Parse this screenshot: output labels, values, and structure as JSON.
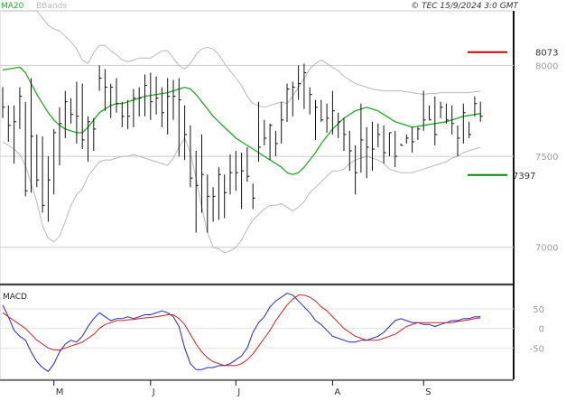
{
  "header": {
    "copyright": "© TEC 15/9/2024 3:0 GMT",
    "legend": [
      {
        "label": "MA20",
        "color": "#22aa22"
      },
      {
        "label": "BBands",
        "color": "#b8b8b8"
      }
    ]
  },
  "macd_panel": {
    "title": "MACD"
  },
  "colors": {
    "price_bars": "#111111",
    "ma20": "#22aa22",
    "bbands": "#b8b8b8",
    "macd_line": "#2222cc",
    "signal_line": "#cc2222",
    "resistance": "#cc0000",
    "support": "#008800",
    "gridline": "#cccccc"
  },
  "levels": [
    {
      "name": "resistance",
      "label": "8073",
      "value": 8073
    },
    {
      "name": "support",
      "label": "7397",
      "value": 7397
    }
  ],
  "chart_data": [
    {
      "type": "line",
      "panel": "price",
      "title": "",
      "xlabel": "",
      "ylabel": "",
      "x_ticks": [
        "M",
        "J",
        "J",
        "A",
        "S"
      ],
      "y_ticks": [
        "8000",
        "7500",
        "7000"
      ],
      "ylim": [
        6800,
        8300
      ],
      "grid": true,
      "legend_position": "top-left",
      "series": [
        {
          "name": "MA20",
          "style": "line",
          "values": [
            7975,
            7980,
            7985,
            7990,
            7960,
            7900,
            7840,
            7790,
            7740,
            7700,
            7670,
            7650,
            7640,
            7630,
            7630,
            7660,
            7700,
            7740,
            7760,
            7780,
            7790,
            7790,
            7800,
            7810,
            7820,
            7830,
            7835,
            7840,
            7845,
            7850,
            7860,
            7870,
            7880,
            7870,
            7840,
            7800,
            7760,
            7720,
            7690,
            7660,
            7630,
            7600,
            7580,
            7560,
            7540,
            7520,
            7500,
            7480,
            7460,
            7440,
            7410,
            7400,
            7410,
            7440,
            7480,
            7520,
            7570,
            7610,
            7650,
            7680,
            7710,
            7730,
            7750,
            7760,
            7770,
            7760,
            7750,
            7730,
            7710,
            7690,
            7680,
            7670,
            7660,
            7665,
            7670,
            7675,
            7680,
            7685,
            7690,
            7700,
            7710,
            7720,
            7725,
            7730,
            7735
          ]
        },
        {
          "name": "BBands",
          "style": "line",
          "values": [
            8300,
            8300,
            8300,
            8300,
            8300,
            8300,
            8300,
            8260,
            8220,
            8200,
            8190,
            8160,
            8130,
            8090,
            8030,
            8010,
            8070,
            8110,
            8110,
            8080,
            8060,
            8030,
            8020,
            8030,
            8040,
            8040,
            8040,
            8060,
            8080,
            8080,
            8040,
            8000,
            7980,
            8010,
            8060,
            8090,
            8100,
            8090,
            8060,
            8010,
            7970,
            7930,
            7890,
            7830,
            7790,
            7780,
            7770,
            7780,
            7790,
            7800,
            7790,
            7830,
            7880,
            7930,
            7980,
            8010,
            8030,
            8010,
            7990,
            7970,
            7940,
            7920,
            7900,
            7890,
            7880,
            7870,
            7865,
            7860,
            7860,
            7860,
            7860,
            7855,
            7850,
            7845,
            7840,
            7845,
            7845,
            7850,
            7850,
            7850,
            7850,
            7850,
            7850,
            7855,
            7860
          ]
        },
        {
          "name": "BBands",
          "style": "line",
          "values": [
            7580,
            7560,
            7540,
            7510,
            7450,
            7350,
            7250,
            7120,
            7050,
            7030,
            7060,
            7140,
            7230,
            7290,
            7320,
            7390,
            7430,
            7470,
            7480,
            7480,
            7490,
            7500,
            7500,
            7510,
            7500,
            7490,
            7480,
            7470,
            7460,
            7450,
            7490,
            7550,
            7600,
            7520,
            7380,
            7220,
            7080,
            7000,
            6990,
            6970,
            6980,
            7000,
            7040,
            7100,
            7150,
            7180,
            7210,
            7230,
            7230,
            7240,
            7220,
            7200,
            7220,
            7250,
            7300,
            7330,
            7360,
            7390,
            7420,
            7420,
            7430,
            7460,
            7480,
            7490,
            7500,
            7490,
            7480,
            7460,
            7430,
            7420,
            7410,
            7410,
            7410,
            7420,
            7430,
            7440,
            7450,
            7460,
            7470,
            7490,
            7500,
            7520,
            7530,
            7540,
            7550
          ]
        },
        {
          "name": "Price",
          "style": "bars",
          "high": [
            7880,
            7780,
            7780,
            7880,
            7800,
            7930,
            7620,
            7610,
            7500,
            7650,
            7770,
            7860,
            7820,
            7910,
            7900,
            7720,
            7710,
            8000,
            7980,
            7900,
            7930,
            7800,
            7810,
            7870,
            7880,
            7950,
            7960,
            7940,
            7880,
            7930,
            7920,
            7930,
            7780,
            7670,
            7530,
            7620,
            7400,
            7330,
            7440,
            7400,
            7510,
            7530,
            7520,
            7550,
            7350,
            7800,
            7700,
            7680,
            7640,
            7800,
            7900,
            7910,
            8000,
            8010,
            7880,
            7810,
            7810,
            7790,
            7860,
            7740,
            7710,
            7640,
            7560,
            7790,
            7660,
            7690,
            7680,
            7670,
            7630,
            7640,
            7570,
            7620,
            7660,
            7660,
            7860,
            7780,
            7830,
            7800,
            7790,
            7780,
            7670,
            7790,
            7690,
            7830,
            7800
          ],
          "low": [
            7710,
            7580,
            7460,
            7650,
            7280,
            7300,
            7330,
            7190,
            7140,
            7290,
            7450,
            7600,
            7680,
            7570,
            7540,
            7470,
            7530,
            7860,
            7750,
            7710,
            7740,
            7660,
            7650,
            7660,
            7720,
            7720,
            7700,
            7730,
            7660,
            7620,
            7700,
            7500,
            7480,
            7330,
            7080,
            7190,
            7080,
            7140,
            7150,
            7160,
            7290,
            7310,
            7210,
            7360,
            7210,
            7470,
            7560,
            7480,
            7500,
            7570,
            7690,
            7720,
            7810,
            7760,
            7730,
            7590,
            7690,
            7630,
            7620,
            7600,
            7530,
            7420,
            7290,
            7410,
            7380,
            7420,
            7550,
            7460,
            7500,
            7440,
            7560,
            7570,
            7520,
            7590,
            7640,
            7700,
            7560,
            7710,
            7680,
            7620,
            7500,
            7570,
            7600,
            7720,
            7690
          ],
          "close": [
            7770,
            7670,
            7690,
            7830,
            7310,
            7610,
            7370,
            7230,
            7370,
            7630,
            7680,
            7800,
            7730,
            7720,
            7590,
            7690,
            7650,
            7930,
            7880,
            7880,
            7790,
            7720,
            7720,
            7820,
            7820,
            7890,
            7800,
            7820,
            7740,
            7830,
            7830,
            7810,
            7620,
            7380,
            7340,
            7400,
            7280,
            7280,
            7400,
            7300,
            7410,
            7410,
            7420,
            7390,
            7270,
            7550,
            7600,
            7670,
            7570,
            7700,
            7870,
            7880,
            7900,
            7960,
            7840,
            7770,
            7700,
            7710,
            7750,
            7690,
            7620,
            7530,
            7410,
            7590,
            7550,
            7540,
            7620,
            7520,
            7630,
            7500,
            7560,
            7600,
            7580,
            7650,
            7700,
            7700,
            7620,
            7770,
            7700,
            7680,
            7600,
            7740,
            7620,
            7790,
            7720
          ]
        }
      ]
    },
    {
      "type": "line",
      "panel": "macd",
      "title": "MACD",
      "y_ticks": [
        "50",
        "0",
        "-50"
      ],
      "ylim": [
        -130,
        110
      ],
      "grid": true,
      "series": [
        {
          "name": "MACD",
          "values": [
            60,
            30,
            -5,
            -20,
            -30,
            -60,
            -85,
            -100,
            -110,
            -90,
            -60,
            -40,
            -30,
            -35,
            -20,
            5,
            25,
            40,
            30,
            20,
            25,
            25,
            30,
            25,
            30,
            35,
            35,
            40,
            45,
            40,
            30,
            5,
            -50,
            -90,
            -105,
            -105,
            -100,
            -100,
            -95,
            -95,
            -90,
            -80,
            -70,
            -50,
            -10,
            15,
            30,
            55,
            70,
            80,
            90,
            85,
            70,
            55,
            40,
            20,
            10,
            -5,
            -20,
            -25,
            -30,
            -35,
            -35,
            -30,
            -30,
            -25,
            -20,
            -10,
            5,
            20,
            25,
            20,
            15,
            15,
            10,
            10,
            5,
            10,
            15,
            20,
            20,
            25,
            25,
            30,
            30
          ]
        },
        {
          "name": "Signal",
          "values": [
            40,
            30,
            20,
            10,
            0,
            -15,
            -30,
            -40,
            -50,
            -55,
            -55,
            -50,
            -45,
            -40,
            -35,
            -25,
            -15,
            0,
            10,
            15,
            20,
            20,
            22,
            23,
            25,
            27,
            28,
            30,
            32,
            35,
            35,
            25,
            10,
            -15,
            -40,
            -60,
            -75,
            -85,
            -90,
            -95,
            -95,
            -95,
            -90,
            -80,
            -65,
            -45,
            -25,
            -5,
            20,
            40,
            60,
            75,
            85,
            85,
            80,
            70,
            55,
            45,
            30,
            15,
            0,
            -10,
            -20,
            -25,
            -30,
            -30,
            -30,
            -25,
            -20,
            -15,
            -5,
            5,
            10,
            15,
            15,
            15,
            15,
            15,
            15,
            15,
            18,
            20,
            22,
            25,
            27
          ]
        }
      ]
    }
  ]
}
